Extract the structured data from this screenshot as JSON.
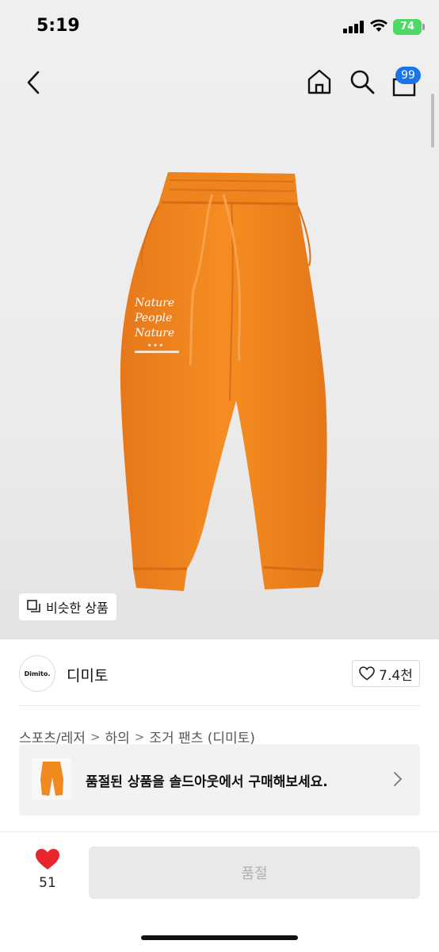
{
  "status_bar": {
    "time": "5:19",
    "battery": "74"
  },
  "header": {
    "cart_count": "99"
  },
  "product_image": {
    "print_lines": [
      "Nature",
      "People",
      "Nature"
    ],
    "print_stars": "★ ★ ★"
  },
  "similar_button": {
    "label": "비슷한 상품"
  },
  "brand": {
    "logo_text": "Dimito.",
    "name": "디미토",
    "likes": "7.4천"
  },
  "breadcrumb": [
    "스포츠/레저",
    "하의",
    "조거 팬츠 (디미토)"
  ],
  "soldout_banner": {
    "text": "품절된 상품을 솔드아웃에서 구매해보세요."
  },
  "bottom_bar": {
    "heart_count": "51",
    "buy_label": "품절"
  },
  "colors": {
    "product_orange": "#f08a1e",
    "badge_blue": "#1a73e8",
    "heart_red": "#e8242c",
    "battery_green": "#4cd964"
  }
}
